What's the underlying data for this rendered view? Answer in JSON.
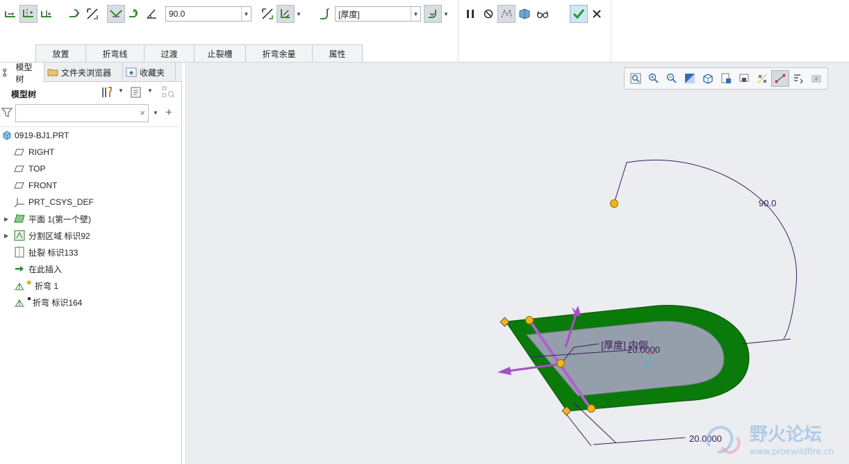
{
  "ribbon": {
    "angle_value": "90.0",
    "thickness_value": "[厚度]",
    "tabs": [
      "放置",
      "折弯线",
      "过渡",
      "止裂槽",
      "折弯余量",
      "属性"
    ]
  },
  "left_panel": {
    "tabs": [
      "模型树",
      "文件夹浏览器",
      "收藏夹"
    ],
    "tree_title": "模型树",
    "search_placeholder": "",
    "clear_icon": "×",
    "tree": [
      {
        "label": "0919-BJ1.PRT",
        "icon": "part-icon"
      },
      {
        "label": "RIGHT",
        "icon": "datum-plane-icon"
      },
      {
        "label": "TOP",
        "icon": "datum-plane-icon"
      },
      {
        "label": "FRONT",
        "icon": "datum-plane-icon"
      },
      {
        "label": "PRT_CSYS_DEF",
        "icon": "csys-icon"
      },
      {
        "label": "平面 1(第一个壁)",
        "icon": "flat-wall-icon"
      },
      {
        "label": "分割区域 标识92",
        "icon": "split-area-icon"
      },
      {
        "label": "扯裂 标识133",
        "icon": "rip-icon"
      },
      {
        "label": "在此插入",
        "icon": "insert-here-icon"
      },
      {
        "label": "折弯 1",
        "icon": "bend-icon"
      },
      {
        "label": "折弯 标识164",
        "icon": "bend-icon"
      }
    ]
  },
  "canvas": {
    "dim_angle": "90.0",
    "dim_thickness_label": "[厚度] 内侧",
    "dim_inner": "20.0000",
    "dim_bottom": "20.0000",
    "colors": {
      "wall": "#0a7a0a",
      "face": "#959fab",
      "handle": "#f2b51a",
      "arrow": "#a84ec8",
      "dim": "#3a1a5a"
    }
  },
  "watermark": {
    "title": "野火论坛",
    "url": "www.proewildfire.cn"
  }
}
